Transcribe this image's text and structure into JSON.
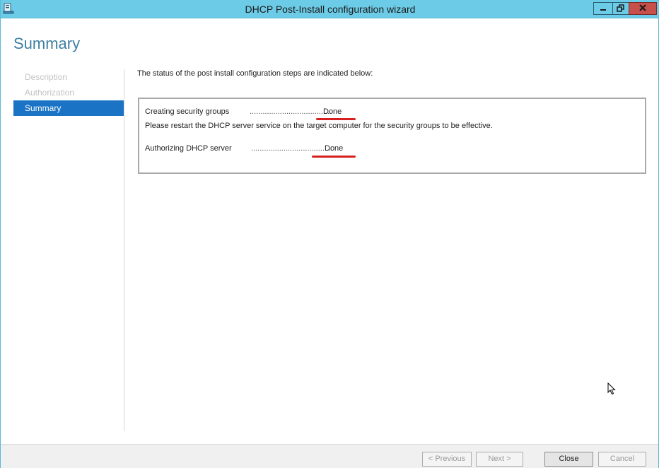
{
  "window": {
    "title": "DHCP Post-Install configuration wizard"
  },
  "page": {
    "title": "Summary"
  },
  "nav": {
    "items": [
      {
        "label": "Description",
        "active": false
      },
      {
        "label": "Authorization",
        "active": false
      },
      {
        "label": "Summary",
        "active": true
      }
    ]
  },
  "content": {
    "intro": "The status of the post install configuration steps are indicated below:",
    "steps": [
      {
        "label": "Creating security groups",
        "dots": "......................................",
        "status": "Done",
        "note": "Please restart the DHCP server service on the target computer for the security groups to be effective."
      },
      {
        "label": "Authorizing DHCP server",
        "dots": "......................................",
        "status": "Done"
      }
    ]
  },
  "footer": {
    "previous_label": "< Previous",
    "next_label": "Next >",
    "close_label": "Close",
    "cancel_label": "Cancel"
  },
  "colors": {
    "titlebar": "#6ccbe6",
    "accent": "#1a73c5",
    "annotation": "#d62020"
  }
}
